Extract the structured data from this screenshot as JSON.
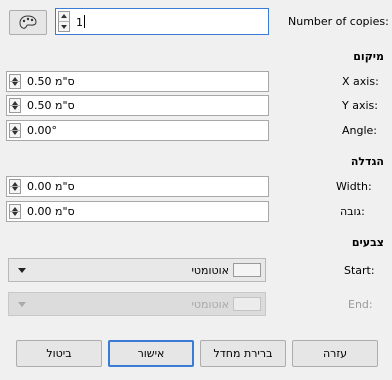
{
  "copies": {
    "label": "Number of copies:",
    "value": "1"
  },
  "placement": {
    "heading": "מיקום",
    "x_axis": {
      "label": "X axis:",
      "value": "0.50 ס\"מ"
    },
    "y_axis": {
      "label": "Y axis:",
      "value": "0.50 ס\"מ"
    },
    "angle": {
      "label": "Angle:",
      "value": "0.00°"
    }
  },
  "enlargement": {
    "heading": "הגדלה",
    "width": {
      "label": "Width:",
      "value": "0.00 ס\"מ"
    },
    "height": {
      "label": "גובה:",
      "value": "0.00 ס\"מ"
    }
  },
  "colors": {
    "heading": "צבעים",
    "start": {
      "label": "Start:",
      "value": "אוטומטי"
    },
    "end": {
      "label": "End:",
      "value": "אוטומטי"
    }
  },
  "buttons": {
    "help": "עזרה",
    "reset": "ברירת מחדל",
    "ok": "אישור",
    "cancel": "ביטול"
  },
  "icons": {
    "palette": "palette-icon",
    "dropdown": "chevron-down-icon",
    "spin": "spin-updown-icon"
  }
}
